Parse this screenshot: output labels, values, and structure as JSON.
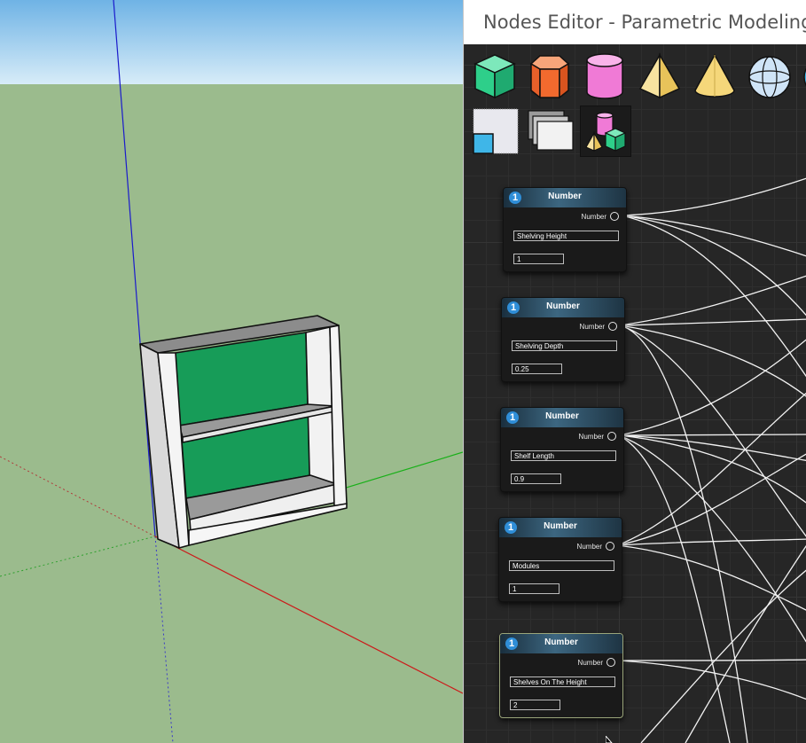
{
  "window": {
    "title": "Nodes Editor - Parametric Modeling",
    "accent": "#d9382f"
  },
  "toolbar": {
    "tools": [
      {
        "name": "cube-tool",
        "icon": "cube-icon",
        "color": "#2ecf8a"
      },
      {
        "name": "prism-tool",
        "icon": "hexagonal-prism-icon",
        "color": "#f26a2e"
      },
      {
        "name": "cylinder-tool",
        "icon": "cylinder-icon",
        "color": "#f07ad6"
      },
      {
        "name": "pyramid-tool",
        "icon": "pyramid-icon",
        "color": "#f5d77a"
      },
      {
        "name": "cone-tool",
        "icon": "cone-icon",
        "color": "#f5d77a"
      },
      {
        "name": "sphere-tool",
        "icon": "sphere-icon",
        "color": "#b9d8f5"
      },
      {
        "name": "rectangle-tool",
        "icon": "rectangle-icon",
        "color": "#3fb6e8"
      },
      {
        "name": "layers-tool",
        "icon": "layers-icon",
        "color": "#e8e8e8"
      },
      {
        "name": "group-tool",
        "icon": "group-shapes-icon",
        "color": "#2ecf8a",
        "active": true
      }
    ]
  },
  "nodes": [
    {
      "title": "Number",
      "badge": "1",
      "output": "Number",
      "name": "Shelving Height",
      "value": "1"
    },
    {
      "title": "Number",
      "badge": "1",
      "output": "Number",
      "name": "Shelving Depth",
      "value": "0.25"
    },
    {
      "title": "Number",
      "badge": "1",
      "output": "Number",
      "name": "Shelf Length",
      "value": "0.9"
    },
    {
      "title": "Number",
      "badge": "1",
      "output": "Number",
      "name": "Modules",
      "value": "1"
    },
    {
      "title": "Number",
      "badge": "1",
      "output": "Number",
      "name": "Shelves On The Height",
      "value": "2",
      "selected": true
    }
  ],
  "scene": {
    "sky_top": "#6fb3e5",
    "sky_bottom": "#d7ecf8",
    "ground": "#9bbb8d",
    "panel_color": "#179c58"
  }
}
